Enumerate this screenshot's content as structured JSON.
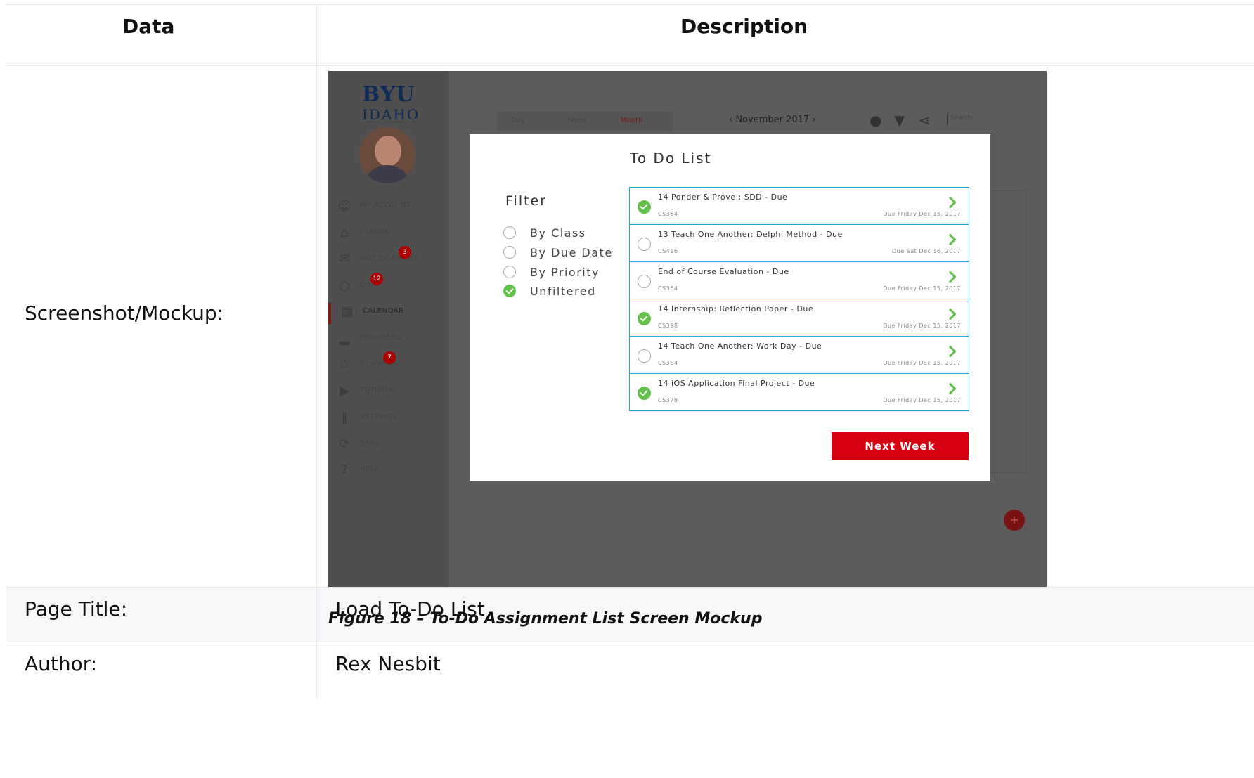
{
  "table": {
    "header": {
      "col1": "Data",
      "col2": "Description"
    },
    "rows": {
      "screenshot_label": "Screenshot/Mockup:",
      "page_title_label": "Page Title:",
      "page_title_value": "Load To-Do List",
      "author_label": "Author:",
      "author_value": "Rex Nesbit"
    }
  },
  "figure": {
    "caption": "Figure 18 – To-Do Assignment List Screen Mockup"
  },
  "mockup": {
    "logo_top": "BYU",
    "logo_bottom": "IDAHO",
    "nav": [
      {
        "label": "MY ACCOUNT",
        "icon": "user-icon"
      },
      {
        "label": "I-LEARN",
        "icon": "home-icon"
      },
      {
        "label": "NOTIFICATIONS",
        "icon": "mail-icon",
        "badge": "3"
      },
      {
        "label": "CHAT",
        "icon": "chat-icon",
        "badge": "12"
      },
      {
        "label": "CALENDAR",
        "icon": "calendar-icon"
      },
      {
        "label": "PROGRESS",
        "icon": "bar-chart-icon"
      },
      {
        "label": "REWARDS",
        "icon": "trophy-icon",
        "badge": "7"
      },
      {
        "label": "TUTORIAL",
        "icon": "video-icon"
      },
      {
        "label": "SETTINGS",
        "icon": "sliders-icon"
      },
      {
        "label": "SYNC",
        "icon": "sync-icon"
      },
      {
        "label": "HELP",
        "icon": "help-icon"
      }
    ],
    "view_tabs": [
      "Day",
      "Week",
      "Month"
    ],
    "month_label": "November 2017",
    "search_placeholder": "Search",
    "modal": {
      "title": "To Do List",
      "filter_title": "Filter",
      "filters": [
        {
          "label": "By Class",
          "selected": false
        },
        {
          "label": "By Due Date",
          "selected": false
        },
        {
          "label": "By Priority",
          "selected": false
        },
        {
          "label": "Unfiltered",
          "selected": true
        }
      ],
      "items": [
        {
          "title": "14 Ponder & Prove : SDD - Due",
          "course": "CS364",
          "due": "Due Friday Dec 15, 2017",
          "done": true
        },
        {
          "title": "13 Teach One Another: Delphi Method - Due",
          "course": "CS416",
          "due": "Due Sat Dec 16, 2017",
          "done": false
        },
        {
          "title": "End of Course Evaluation - Due",
          "course": "CS364",
          "due": "Due Friday Dec 15, 2017",
          "done": false
        },
        {
          "title": "14 Internship: Reflection Paper - Due",
          "course": "CS398",
          "due": "Due Friday Dec 15, 2017",
          "done": true
        },
        {
          "title": "14 Teach One Another: Work Day - Due",
          "course": "CS364",
          "due": "Due Friday Dec 15, 2017",
          "done": false
        },
        {
          "title": "14 iOS Application Final Project - Due",
          "course": "CS378",
          "due": "Due Friday Dec 15, 2017",
          "done": true
        }
      ],
      "next_button": "Next Week"
    },
    "colors": {
      "accent_red": "#d60012",
      "check_green": "#62c14a",
      "item_border": "#21a0d8"
    }
  }
}
